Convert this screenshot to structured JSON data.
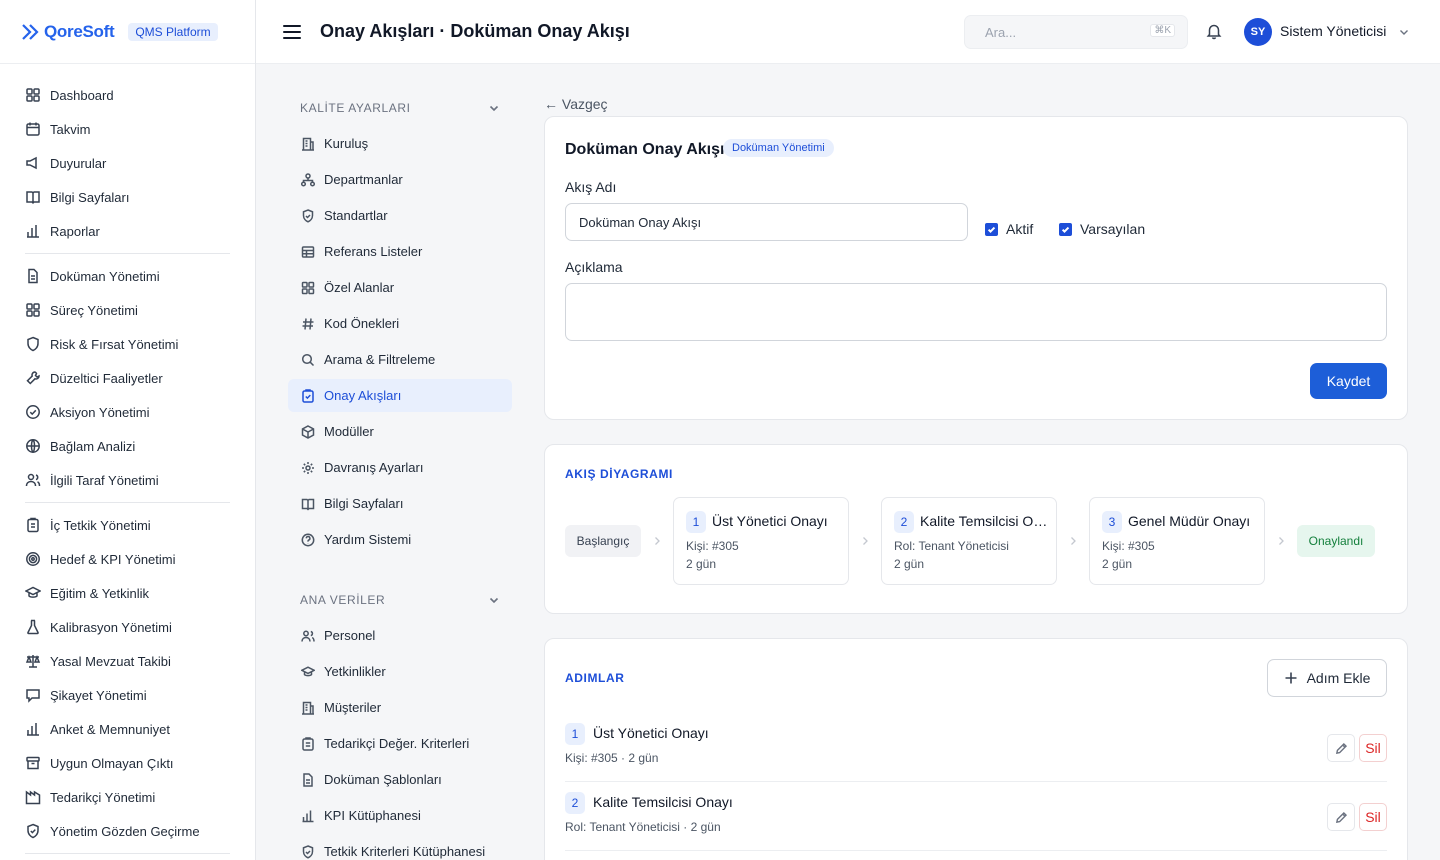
{
  "brand": {
    "logo_text": "QoreSoft",
    "platform": "QMS Platform"
  },
  "topbar": {
    "title": "Onay Akışları · Doküman Onay Akışı",
    "search_placeholder": "Ara...",
    "shortcut": "⌘K",
    "avatar_initials": "SY",
    "user_name": "Sistem Yöneticisi"
  },
  "nav": {
    "group1": [
      {
        "label": "Dashboard",
        "icon": "grid-icon"
      },
      {
        "label": "Takvim",
        "icon": "calendar-icon"
      },
      {
        "label": "Duyurular",
        "icon": "megaphone-icon"
      },
      {
        "label": "Bilgi Sayfaları",
        "icon": "book-icon"
      },
      {
        "label": "Raporlar",
        "icon": "bar-chart-icon"
      }
    ],
    "group2": [
      {
        "label": "Doküman Yönetimi",
        "icon": "document-icon"
      },
      {
        "label": "Süreç Yönetimi",
        "icon": "grid-icon"
      },
      {
        "label": "Risk & Fırsat Yönetimi",
        "icon": "shield-icon"
      },
      {
        "label": "Düzeltici Faaliyetler",
        "icon": "wrench-icon"
      },
      {
        "label": "Aksiyon Yönetimi",
        "icon": "check-circle-icon"
      },
      {
        "label": "Bağlam Analizi",
        "icon": "globe-icon"
      },
      {
        "label": "İlgili Taraf Yönetimi",
        "icon": "users-icon"
      }
    ],
    "group3": [
      {
        "label": "İç Tetkik Yönetimi",
        "icon": "clipboard-icon"
      },
      {
        "label": "Hedef & KPI Yönetimi",
        "icon": "target-icon"
      },
      {
        "label": "Eğitim & Yetkinlik",
        "icon": "graduation-cap-icon"
      },
      {
        "label": "Kalibrasyon Yönetimi",
        "icon": "flask-icon"
      },
      {
        "label": "Yasal Mevzuat Takibi",
        "icon": "scale-icon"
      },
      {
        "label": "Şikayet Yönetimi",
        "icon": "message-icon"
      },
      {
        "label": "Anket & Memnuniyet",
        "icon": "bar-chart-icon"
      },
      {
        "label": "Uygun Olmayan Çıktı",
        "icon": "archive-icon"
      },
      {
        "label": "Tedarikçi Yönetimi",
        "icon": "factory-icon"
      },
      {
        "label": "Yönetim Gözden Geçirme",
        "icon": "shield-check-icon"
      }
    ]
  },
  "settings": {
    "section1_title": "KALİTE AYARLARI",
    "section1_items": [
      {
        "label": "Kuruluş",
        "icon": "building-icon"
      },
      {
        "label": "Departmanlar",
        "icon": "org-chart-icon"
      },
      {
        "label": "Standartlar",
        "icon": "shield-check-icon"
      },
      {
        "label": "Referans Listeler",
        "icon": "table-icon"
      },
      {
        "label": "Özel Alanlar",
        "icon": "grid-icon"
      },
      {
        "label": "Kod Önekleri",
        "icon": "hash-icon"
      },
      {
        "label": "Arama & Filtreleme",
        "icon": "search-icon"
      },
      {
        "label": "Onay Akışları",
        "icon": "clipboard-check-icon"
      },
      {
        "label": "Modüller",
        "icon": "package-icon"
      },
      {
        "label": "Davranış Ayarları",
        "icon": "gear-icon"
      },
      {
        "label": "Bilgi Sayfaları",
        "icon": "book-icon"
      },
      {
        "label": "Yardım Sistemi",
        "icon": "help-circle-icon"
      }
    ],
    "section2_title": "ANA VERİLER",
    "section2_items": [
      {
        "label": "Personel",
        "icon": "users-icon"
      },
      {
        "label": "Yetkinlikler",
        "icon": "graduation-cap-icon"
      },
      {
        "label": "Müşteriler",
        "icon": "building-icon"
      },
      {
        "label": "Tedarikçi Değer. Kriterleri",
        "icon": "clipboard-icon"
      },
      {
        "label": "Doküman Şablonları",
        "icon": "document-icon"
      },
      {
        "label": "KPI Kütüphanesi",
        "icon": "bar-chart-icon"
      },
      {
        "label": "Tetkik Kriterleri Kütüphanesi",
        "icon": "shield-check-icon"
      }
    ]
  },
  "main": {
    "back_label": "← Vazgeç",
    "form": {
      "title": "Doküman Onay Akışı",
      "badge": "Doküman Yönetimi",
      "name_label": "Akış Adı",
      "name_value": "Doküman Onay Akışı",
      "active_label": "Aktif",
      "default_label": "Varsayılan",
      "desc_label": "Açıklama",
      "desc_value": "",
      "save_label": "Kaydet"
    },
    "diagram": {
      "title": "AKIŞ DİYAGRAMI",
      "start_label": "Başlangıç",
      "end_label": "Onaylandı",
      "steps": [
        {
          "num": "1",
          "name": "Üst Yönetici Onayı",
          "assignee": "Kişi: #305",
          "duration": "2 gün"
        },
        {
          "num": "2",
          "name": "Kalite Temsilcisi Onayı",
          "assignee": "Rol: Tenant Yöneticisi",
          "duration": "2 gün"
        },
        {
          "num": "3",
          "name": "Genel Müdür Onayı",
          "assignee": "Kişi: #305",
          "duration": "2 gün"
        }
      ]
    },
    "steps_card": {
      "title": "ADIMLAR",
      "add_label": "Adım Ekle",
      "delete_label": "Sil",
      "rows": [
        {
          "num": "1",
          "name": "Üst Yönetici Onayı",
          "meta": "Kişi: #305 · 2 gün"
        },
        {
          "num": "2",
          "name": "Kalite Temsilcisi Onayı",
          "meta": "Rol: Tenant Yöneticisi · 2 gün"
        }
      ]
    }
  }
}
